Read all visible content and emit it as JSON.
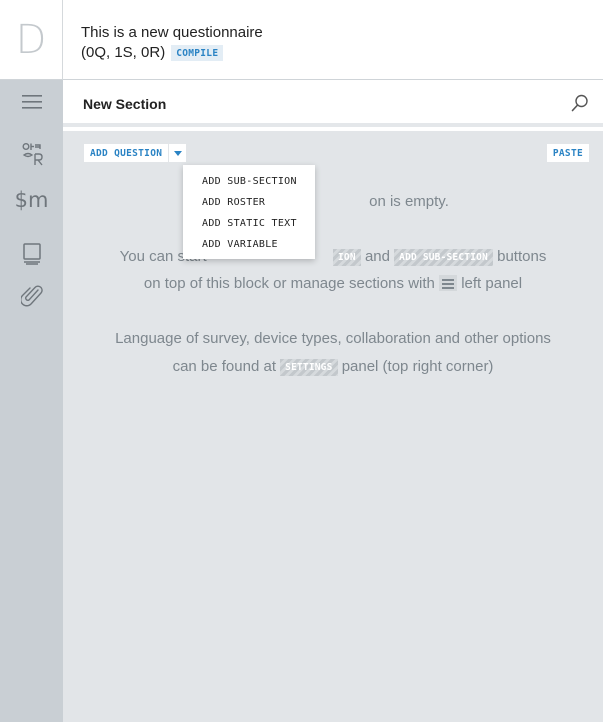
{
  "app": {
    "logo_letter": "D"
  },
  "rail": {
    "items": [
      {
        "icon": "hamburger-menu-icon"
      },
      {
        "icon": "translation-icon",
        "text_top": "ab",
        "text_bottom": "cя"
      },
      {
        "icon": "macros-icon",
        "text": "$m"
      },
      {
        "icon": "lookup-tables-icon"
      },
      {
        "icon": "attachments-icon"
      }
    ]
  },
  "header": {
    "title": "This is a new questionnaire",
    "stats": "(0Q, 1S, 0R)",
    "compile_label": "COMPILE"
  },
  "section": {
    "title": "New Section",
    "search_icon": "search-icon"
  },
  "toolbar": {
    "add_question_label": "ADD QUESTION",
    "paste_label": "PASTE"
  },
  "dropdown": {
    "items": [
      "ADD SUB-SECTION",
      "ADD ROSTER",
      "ADD STATIC TEXT",
      "ADD VARIABLE"
    ]
  },
  "empty_state": {
    "line1": "on is empty.",
    "line2_a": "You can start",
    "line2_tag1": "ION",
    "line2_b": "and",
    "line2_tag2": "ADD SUB-SECTION",
    "line2_c": "buttons",
    "line3_a": "on top of this block or manage sections with",
    "line3_b": "left panel",
    "line4": "Language of survey, device types, collaboration and other options",
    "line5_a": "can be found at",
    "line5_tag": "SETTINGS",
    "line5_b": "panel (top right corner)"
  },
  "colors": {
    "accent": "#2a83c4",
    "rail_bg": "#c9cfd4",
    "main_bg": "#e2e5e8",
    "muted_text": "#7e878e"
  }
}
